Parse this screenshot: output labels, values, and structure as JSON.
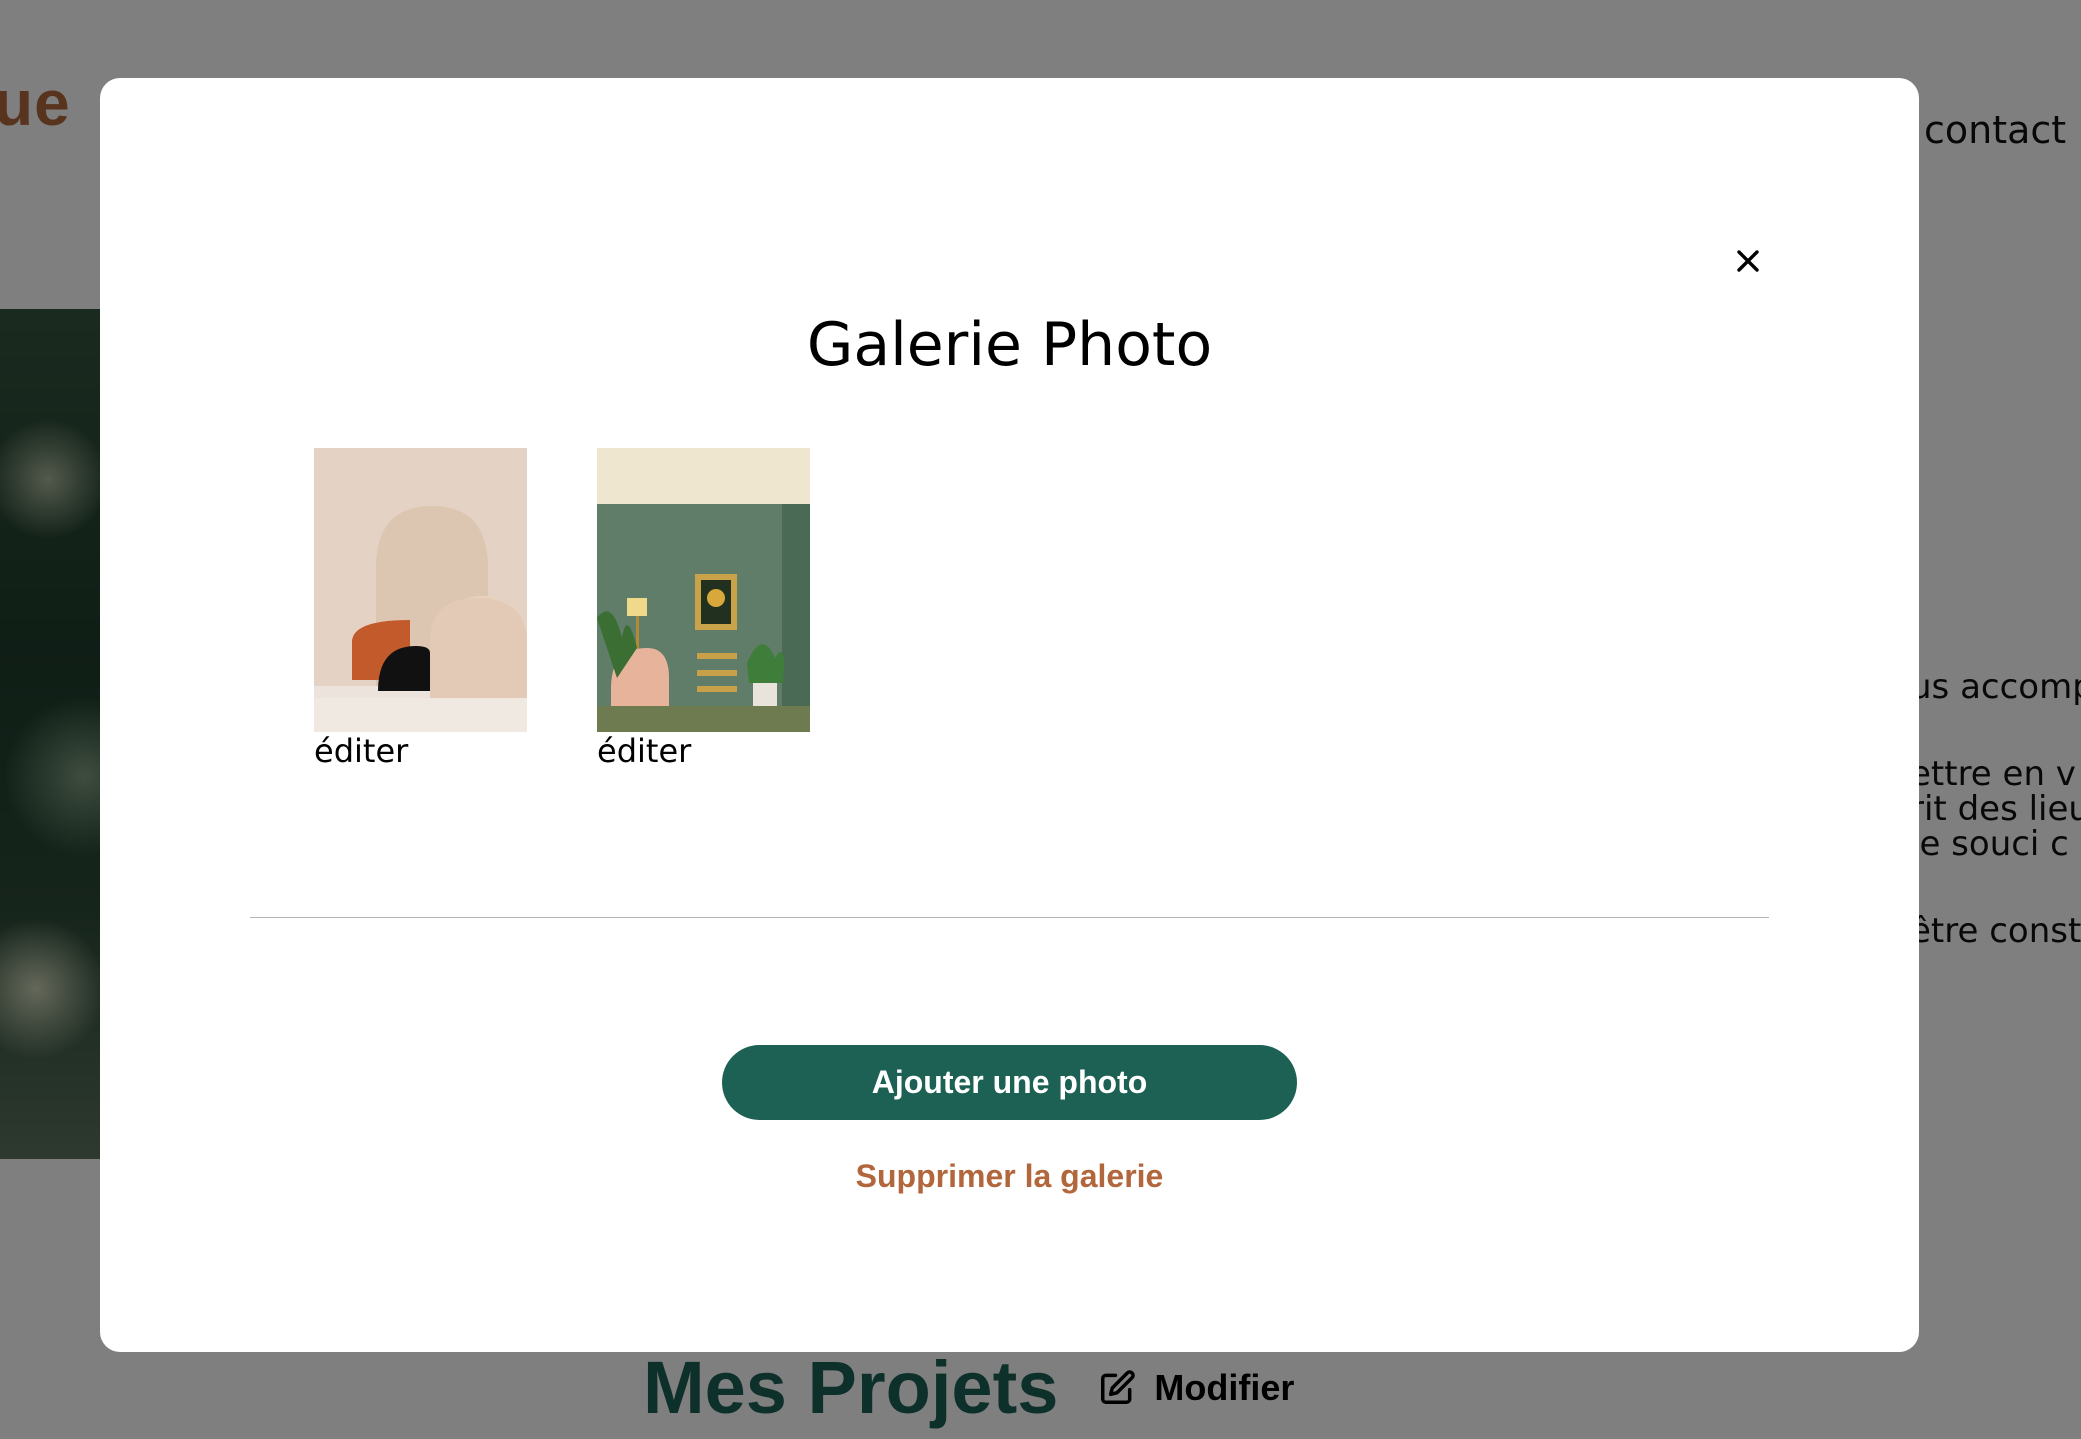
{
  "background": {
    "logo_fragment": "ue",
    "nav_contact": "contact",
    "about_lines": [
      [
        "us accomp"
      ],
      [
        "ettre en v",
        "rit des lieu",
        " le souci c"
      ],
      [
        "être const"
      ]
    ],
    "projects_title": "Mes Projets",
    "edit_link": "Modifier"
  },
  "modal": {
    "title": "Galerie Photo",
    "close_icon": "close-icon",
    "photos": [
      {
        "edit_label": "éditer",
        "alt": "arches"
      },
      {
        "edit_label": "éditer",
        "alt": "salon vert"
      }
    ],
    "add_button": "Ajouter une photo",
    "delete_link": "Supprimer la galerie"
  },
  "colors": {
    "brand_green": "#1d6154",
    "brand_terracotta": "#b1663c",
    "overlay": "rgba(0,0,0,0.5)"
  }
}
